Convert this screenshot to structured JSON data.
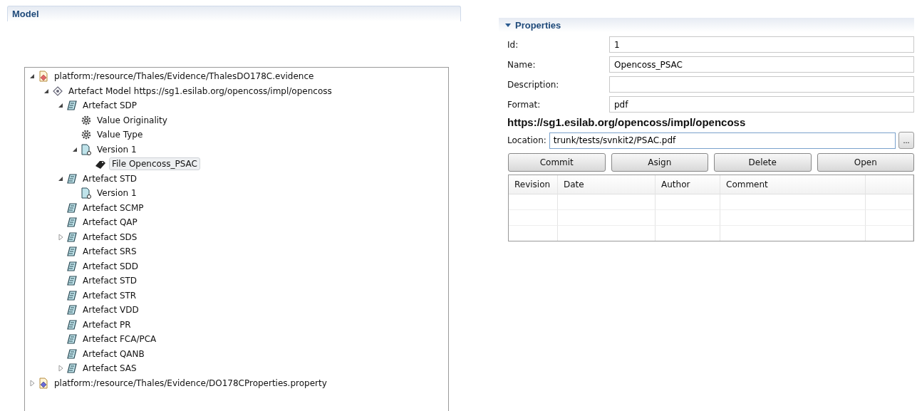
{
  "model_panel": {
    "title": "Model"
  },
  "tree": [
    {
      "label": "platform:/resource/Thales/Evidence/ThalesDO178C.evidence",
      "kind": "resource",
      "expanded": true,
      "selected": false,
      "children": [
        {
          "label": "Artefact Model https://sg1.esilab.org/opencoss/impl/opencoss",
          "kind": "model",
          "expanded": true,
          "selected": false,
          "children": [
            {
              "label": "Artefact SDP",
              "kind": "artefact",
              "expanded": true,
              "selected": false,
              "children": [
                {
                  "label": "Value Originality",
                  "kind": "setting",
                  "selected": false
                },
                {
                  "label": "Value Type",
                  "kind": "setting",
                  "selected": false
                },
                {
                  "label": "Version 1",
                  "kind": "version",
                  "expanded": true,
                  "selected": false,
                  "children": [
                    {
                      "label": "File Opencoss_PSAC",
                      "kind": "file",
                      "selected": true
                    }
                  ]
                }
              ]
            },
            {
              "label": "Artefact STD",
              "kind": "artefact",
              "expanded": true,
              "selected": false,
              "children": [
                {
                  "label": "Version 1",
                  "kind": "version",
                  "selected": false
                }
              ]
            },
            {
              "label": "Artefact SCMP",
              "kind": "artefact",
              "selected": false
            },
            {
              "label": "Artefact QAP",
              "kind": "artefact",
              "selected": false
            },
            {
              "label": "Artefact SDS",
              "kind": "artefact",
              "expanded": false,
              "selected": false
            },
            {
              "label": "Artefact SRS",
              "kind": "artefact",
              "selected": false
            },
            {
              "label": "Artefact SDD",
              "kind": "artefact",
              "selected": false
            },
            {
              "label": "Artefact STD",
              "kind": "artefact",
              "selected": false
            },
            {
              "label": "Artefact STR",
              "kind": "artefact",
              "selected": false
            },
            {
              "label": "Artefact VDD",
              "kind": "artefact",
              "selected": false
            },
            {
              "label": "Artefact PR",
              "kind": "artefact",
              "selected": false
            },
            {
              "label": "Artefact FCA/PCA",
              "kind": "artefact",
              "selected": false
            },
            {
              "label": "Artefact QANB",
              "kind": "artefact",
              "selected": false
            },
            {
              "label": "Artefact SAS",
              "kind": "artefact",
              "expanded": false,
              "selected": false
            }
          ]
        }
      ]
    },
    {
      "label": "platform:/resource/Thales/Evidence/DO178CProperties.property",
      "kind": "property",
      "expanded": false,
      "selected": false
    }
  ],
  "properties": {
    "title": "Properties",
    "expanded": true,
    "fields": [
      {
        "label": "Id:",
        "value": "1"
      },
      {
        "label": "Name:",
        "value": "Opencoss_PSAC"
      },
      {
        "label": "Description:"
      },
      {
        "label": "Format:",
        "value": "pdf"
      }
    ],
    "repository_url": "https://sg1.esilab.org/opencoss/impl/opencoss",
    "location": {
      "label": "Location:",
      "value": "trunk/tests/svnkit2/PSAC.pdf",
      "browse": "..."
    },
    "buttons": [
      "Commit",
      "Asign",
      "Delete",
      "Open"
    ],
    "history_table": {
      "columns": [
        "Revision",
        "Date",
        "Author",
        "Comment"
      ]
    }
  }
}
